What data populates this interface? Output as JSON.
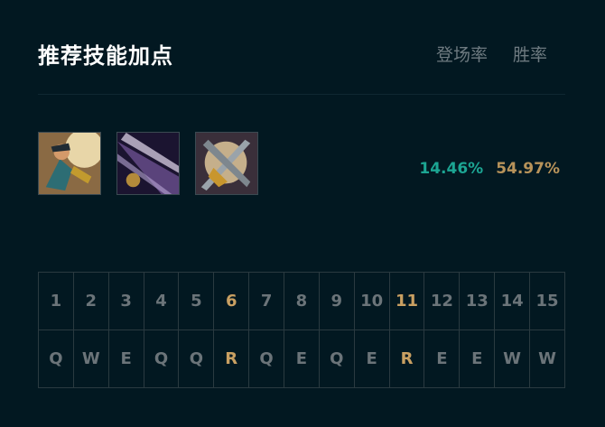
{
  "header": {
    "title": "推荐技能加点",
    "tabs": [
      {
        "label": "登场率"
      },
      {
        "label": "胜率"
      }
    ]
  },
  "skill_build": {
    "icons": [
      {
        "name": "skill-q-icon"
      },
      {
        "name": "skill-w-icon"
      },
      {
        "name": "skill-e-icon"
      }
    ],
    "pick_rate": "14.46%",
    "win_rate": "54.97%"
  },
  "level_order": {
    "levels": [
      "1",
      "2",
      "3",
      "4",
      "5",
      "6",
      "7",
      "8",
      "9",
      "10",
      "11",
      "12",
      "13",
      "14",
      "15"
    ],
    "skills": [
      "Q",
      "W",
      "E",
      "Q",
      "Q",
      "R",
      "Q",
      "E",
      "Q",
      "E",
      "R",
      "E",
      "E",
      "W",
      "W"
    ],
    "highlight_color": "#c9a062",
    "normal_color": "#6b7479"
  }
}
